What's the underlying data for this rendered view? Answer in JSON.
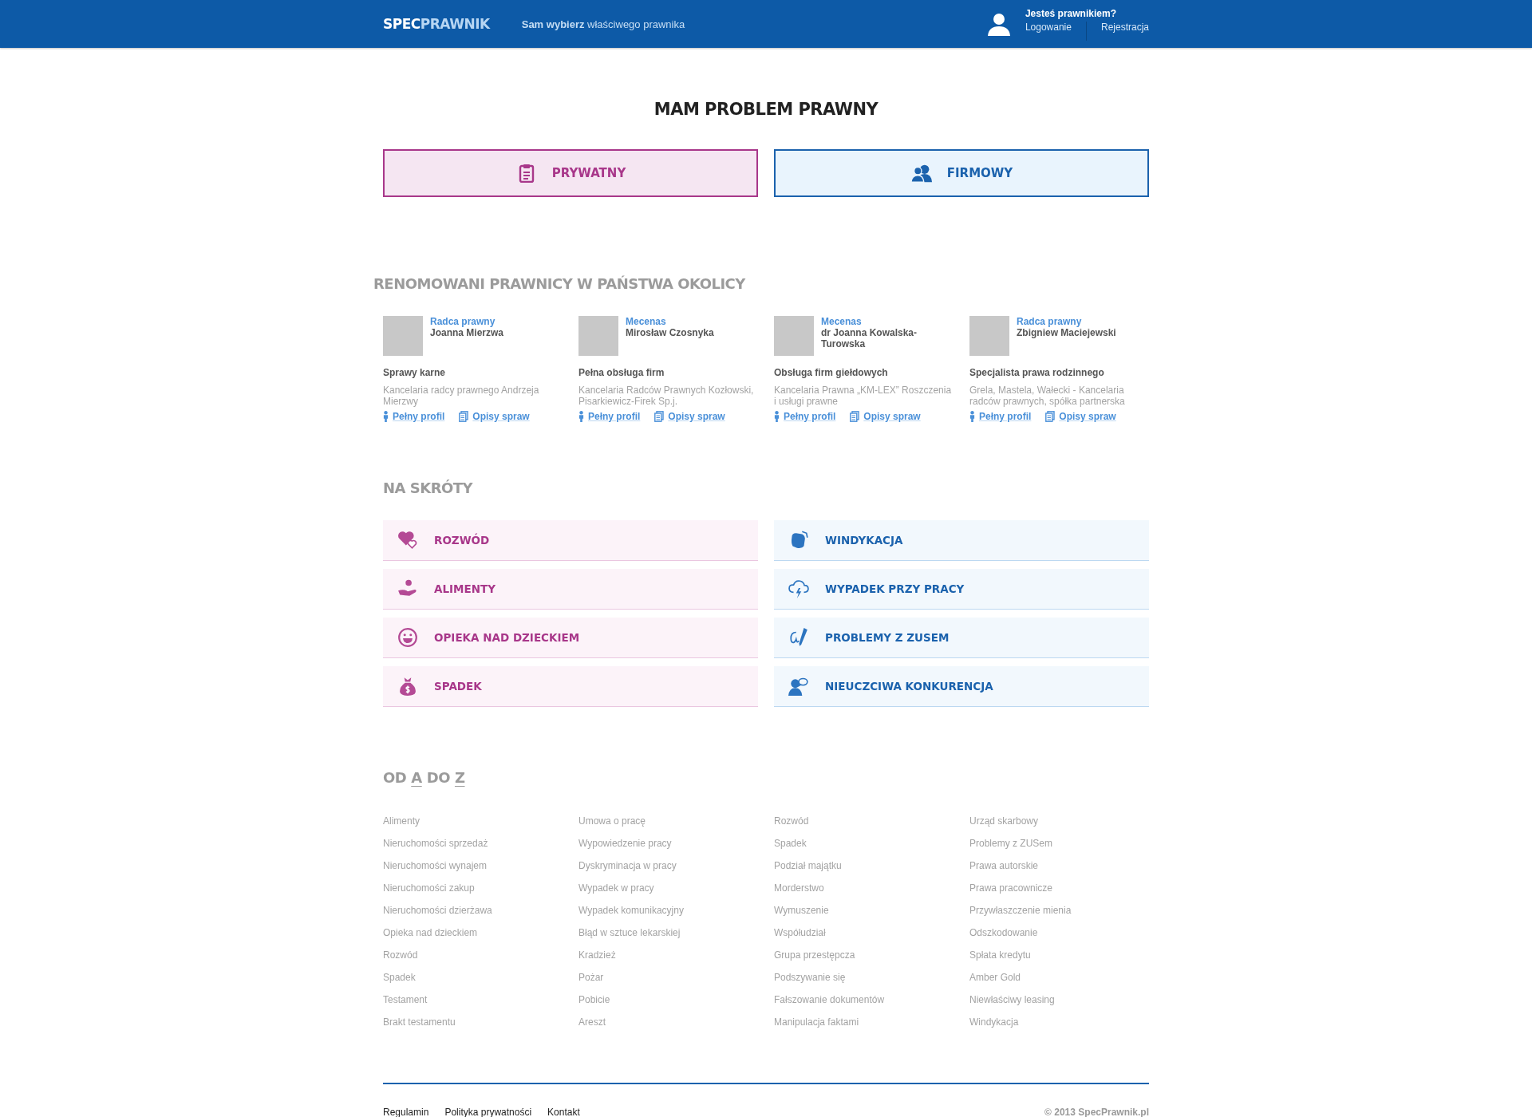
{
  "header": {
    "logo": {
      "first": "SPEC",
      "second": "PRAWNIK"
    },
    "tagline": "**Sam wybierz** właściwego prawnika",
    "account": {
      "question": "Jesteś prawnikiem?",
      "links": [
        "Logowanie",
        "Rejestracja"
      ]
    }
  },
  "problem": {
    "title": "MAM PROBLEM PRAWNY",
    "options": [
      {
        "kind": "private",
        "label": "PRYWATNY"
      },
      {
        "kind": "business",
        "label": "FIRMOWY"
      }
    ]
  },
  "lawyers": {
    "title": "RENOMOWANI PRAWNICY W PAŃSTWA OKOLICY",
    "items": [
      {
        "title": "Radca prawny",
        "name": "Joanna Mierzwa",
        "specialty": "Sprawy karne",
        "firm": "Kancelaria radcy prawnego Andrzeja Mierzwy",
        "links": [
          "Pełny profil",
          "Opisy spraw"
        ]
      },
      {
        "title": "Mecenas",
        "name": "Mirosław Czosnyka",
        "specialty": "Pełna obsługa firm",
        "firm": "Kancelaria Radców Prawnych Kozłowski, Pisarkiewicz-Firek Sp.j.",
        "links": [
          "Pełny profil",
          "Opisy spraw"
        ]
      },
      {
        "title": "Mecenas",
        "name": "dr Joanna Kowalska-Turowska",
        "specialty": "Obsługa firm giełdowych",
        "firm": "Kancelaria Prawna „KM-LEX” Roszczenia i usługi prawne",
        "links": [
          "Pełny profil",
          "Opisy spraw"
        ]
      },
      {
        "title": "Radca prawny",
        "name": "Zbigniew Maciejewski",
        "specialty": "Specjalista prawa rodzinnego",
        "firm": "Grela, Mastela, Wałecki - Kancelaria radców prawnych, spółka partnerska",
        "links": [
          "Pełny profil",
          "Opisy spraw"
        ]
      }
    ]
  },
  "shortcuts": {
    "title": "NA SKRÓTY",
    "columns": [
      {
        "kind": "private",
        "items": [
          "ROZWÓD",
          "ALIMENTY",
          "OPIEKA NAD DZIECKIEM",
          "SPADEK"
        ]
      },
      {
        "kind": "business",
        "items": [
          "WINDYKACJA",
          "WYPADEK PRZY PRACY",
          "PROBLEMY Z ZUSEM",
          "NIEUCZCIWA KONKURENCJA"
        ]
      }
    ]
  },
  "a_to_z": {
    "title": [
      {
        "text": "OD",
        "underlined": false
      },
      {
        "text": "A",
        "underlined": true
      },
      {
        "text": "DO",
        "underlined": false
      },
      {
        "text": "Z",
        "underlined": true
      }
    ],
    "columns": [
      [
        "Alimenty",
        "Nieruchomości sprzedaż",
        "Nieruchomości wynajem",
        "Nieruchomości zakup",
        "Nieruchomości dzierżawa",
        "Opieka nad dzieckiem",
        "Rozwód",
        "Spadek",
        "Testament",
        "Brakt testamentu"
      ],
      [
        "Umowa o pracę",
        "Wypowiedzenie pracy",
        "Dyskryminacja w pracy",
        "Wypadek w pracy",
        "Wypadek komunikacyjny",
        "Błąd w sztuce lekarskiej",
        "Kradzież",
        "Pożar",
        "Pobicie",
        "Areszt"
      ],
      [
        "Rozwód",
        "Spadek",
        "Podział majątku",
        "Morderstwo",
        "Wymuszenie",
        "Współudział",
        "Grupa przestępcza",
        "Podszywanie się",
        "Fałszowanie dokumentów",
        "Manipulacja faktami"
      ],
      [
        "Urząd skarbowy",
        "Problemy z ZUSem",
        "Prawa autorskie",
        "Prawa pracownicze",
        "Przywłaszczenie mienia",
        "Odszkodowanie",
        "Spłata kredytu",
        "Amber Gold",
        "Niewłaściwy leasing",
        "Windykacja"
      ]
    ]
  },
  "footer": {
    "links": [
      "Regulamin",
      "Polityka prywatności",
      "Kontakt"
    ],
    "copyright": "© 2013 SpecPrawnik.pl"
  }
}
